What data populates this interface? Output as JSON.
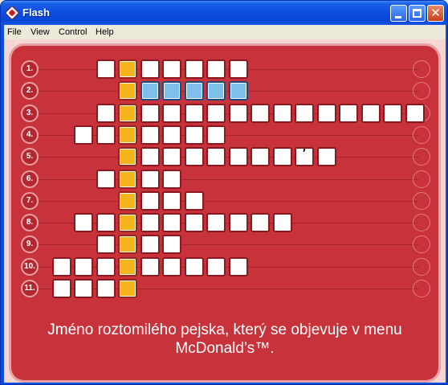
{
  "window": {
    "title": "Flash"
  },
  "menu": [
    "File",
    "View",
    "Control",
    "Help"
  ],
  "crossword": {
    "rows": [
      {
        "label": "1.",
        "start": 4,
        "length": 7
      },
      {
        "label": "2.",
        "start": 5,
        "length": 6,
        "selected": true
      },
      {
        "label": "3.",
        "start": 4,
        "length": 15
      },
      {
        "label": "4.",
        "start": 3,
        "length": 7
      },
      {
        "label": "5.",
        "start": 5,
        "length": 10,
        "marks": {
          "13": "ʼ"
        }
      },
      {
        "label": "6.",
        "start": 4,
        "length": 4
      },
      {
        "label": "7.",
        "start": 5,
        "length": 4
      },
      {
        "label": "8.",
        "start": 3,
        "length": 10
      },
      {
        "label": "9.",
        "start": 4,
        "length": 4
      },
      {
        "label": "10.",
        "start": 2,
        "length": 9
      },
      {
        "label": "11.",
        "start": 2,
        "length": 4
      }
    ],
    "key_column": 5
  },
  "clue": "Jméno roztomilého pejska, který se objevuje v menu McDonald’s™.",
  "colors": {
    "panel": "#c8323a",
    "key_cell": "#f4b41c",
    "selected_cell": "#7ec0ea"
  }
}
